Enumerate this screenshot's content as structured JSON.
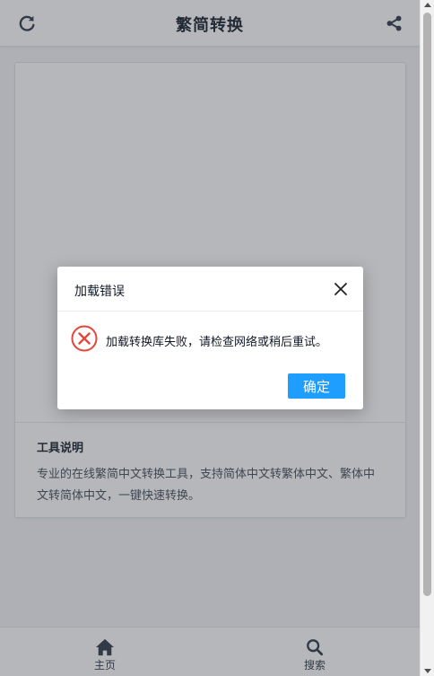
{
  "header": {
    "title": "繁简转换",
    "refresh_icon": "refresh-icon",
    "share_icon": "share-icon"
  },
  "card": {
    "info_title": "工具说明",
    "info_text": "专业的在线繁简中文转换工具，支持简体中文转繁体中文、繁体中文转简体中文，一键快速转换。"
  },
  "bottom_nav": {
    "items": [
      {
        "label": "主页",
        "icon": "home-icon"
      },
      {
        "label": "搜索",
        "icon": "search-icon"
      }
    ]
  },
  "dialog": {
    "title": "加载错误",
    "message": "加载转换库失败，请检查网络或稍后重试。",
    "confirm_label": "确定",
    "close_icon": "close-icon",
    "status_icon": "error-icon"
  },
  "colors": {
    "accent": "#1e9fff",
    "error": "#e5453b",
    "icon": "#374151"
  }
}
